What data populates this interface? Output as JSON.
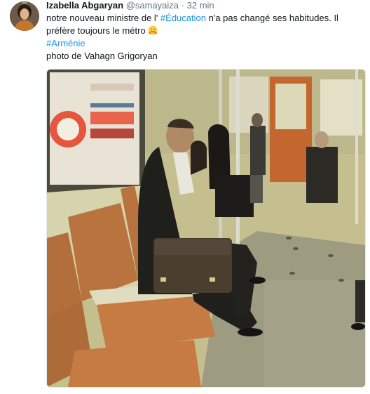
{
  "tweet": {
    "author_name": "Izabella Abgaryan",
    "handle": "@samayaiza",
    "separator": "·",
    "time": "32 min",
    "text_part1": "notre nouveau ministre de l'",
    "hashtag1": "#Éducation",
    "text_part2": "n'a pas changé ses habitudes. Il préfère toujours le métro",
    "emoji": "hugging-face-emoji",
    "hashtag2": "#Arménie",
    "credit": "photo de Vahagn Grigoryan"
  },
  "colors": {
    "link": "#1b95e0",
    "name": "#14171a",
    "meta": "#657786",
    "border": "#e1e8ed"
  }
}
